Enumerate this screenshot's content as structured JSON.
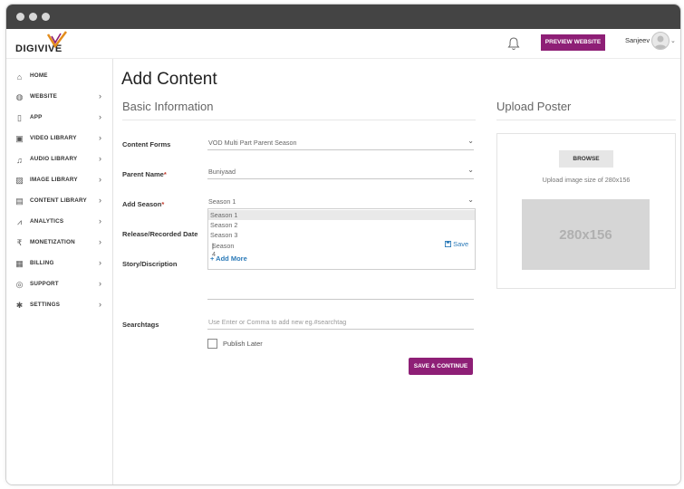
{
  "window": {
    "dots": [
      "#d8d8d8",
      "#d8d8d8",
      "#d8d8d8"
    ]
  },
  "header": {
    "logo_text": "DIGIVIVE",
    "preview_label": "PREVIEW WEBSITE",
    "user_name": "Sanjeev",
    "brand_color": "#8e1f76",
    "bell_icon": "bell-icon",
    "caret_icon": "chevron-down-icon"
  },
  "sidebar": {
    "items": [
      {
        "label": "HOME",
        "icon": "home-icon",
        "glyph": "⌂",
        "has_chevron": false
      },
      {
        "label": "WEBSITE",
        "icon": "globe-icon",
        "glyph": "◍",
        "has_chevron": true
      },
      {
        "label": "APP",
        "icon": "mobile-icon",
        "glyph": "▯",
        "has_chevron": true
      },
      {
        "label": "VIDEO LIBRARY",
        "icon": "video-icon",
        "glyph": "▣",
        "has_chevron": true
      },
      {
        "label": "AUDIO LIBRARY",
        "icon": "music-icon",
        "glyph": "♫",
        "has_chevron": true
      },
      {
        "label": "IMAGE LIBRARY",
        "icon": "image-icon",
        "glyph": "▨",
        "has_chevron": true
      },
      {
        "label": "CONTENT LIBRARY",
        "icon": "content-library-icon",
        "glyph": "▤",
        "has_chevron": true
      },
      {
        "label": "ANALYTICS",
        "icon": "analytics-icon",
        "glyph": "⩘",
        "has_chevron": true
      },
      {
        "label": "MONETIZATION",
        "icon": "rupee-icon",
        "glyph": "₹",
        "has_chevron": true
      },
      {
        "label": "BILLING",
        "icon": "billing-icon",
        "glyph": "▦",
        "has_chevron": true
      },
      {
        "label": "SUPPORT",
        "icon": "support-icon",
        "glyph": "◎",
        "has_chevron": true
      },
      {
        "label": "SETTINGS",
        "icon": "gear-icon",
        "glyph": "✱",
        "has_chevron": true
      }
    ],
    "chevron": "›"
  },
  "main": {
    "title": "Add Content",
    "basic_info_title": "Basic Information",
    "upload_title": "Upload Poster",
    "form": {
      "content_forms_label": "Content Forms",
      "content_forms_value": "VOD Multi Part Parent Season",
      "parent_name_label": "Parent Name",
      "parent_name_value": "Buniyaad",
      "add_season_label": "Add Season",
      "add_season_value": "Season 1",
      "required_mark": "*",
      "release_label": "Release/Recorded Date",
      "story_label": "Story/Discription",
      "searchtags_label": "Searchtags",
      "searchtags_placeholder": "Use Enter or Comma to add new eg.#searchtag",
      "publish_later_label": "Publish Later",
      "publish_later_checked": false,
      "save_continue_label": "SAVE & CONTINUE",
      "caret": "⌄"
    },
    "season_dropdown": {
      "options": [
        "Season 1",
        "Season 2",
        "Season 3",
        "Season 4"
      ],
      "highlighted_index": 0,
      "editing_index": 3,
      "save_label": "Save",
      "save_icon": "save-icon",
      "add_more_label": "+ Add More"
    },
    "poster": {
      "browse_label": "BROWSE",
      "hint": "Upload image size of 280x156",
      "placeholder_text": "280x156"
    }
  }
}
